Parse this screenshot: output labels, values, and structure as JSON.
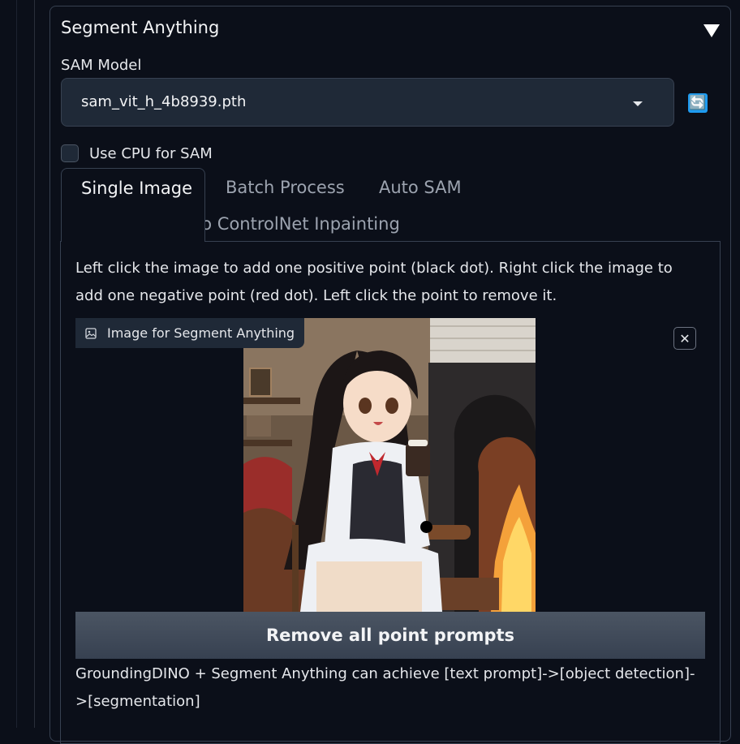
{
  "accordion": {
    "title": "Segment Anything"
  },
  "sam_model": {
    "label": "SAM Model",
    "selected": "sam_vit_h_4b8939.pth"
  },
  "cpu_option": {
    "label": "Use CPU for SAM",
    "checked": false
  },
  "tabs": [
    {
      "label": "Single Image",
      "active": true
    },
    {
      "label": "Batch Process",
      "active": false
    },
    {
      "label": "Auto SAM",
      "active": false
    },
    {
      "label": "Upload Mask to ControlNet Inpainting",
      "active": false
    }
  ],
  "single_image": {
    "instructions": "Left click the image to add one positive point (black dot). Right click the image to add one negative point (red dot). Left click the point to remove it.",
    "image_label": "Image for Segment Anything",
    "remove_button": "Remove all point prompts",
    "grounding_text": "GroundingDINO + Segment Anything can achieve [text prompt]->[object detection]->[segmentation]"
  },
  "icons": {
    "refresh": "refresh-icon",
    "image": "image-icon",
    "close": "close-icon",
    "dropdown": "chevron-down-icon",
    "collapse": "triangle-down-icon"
  },
  "colors": {
    "background": "#0b0f19",
    "panel": "#1f2937",
    "border": "#374151",
    "accent": "#1e9bf0",
    "button": "#4b5563"
  }
}
